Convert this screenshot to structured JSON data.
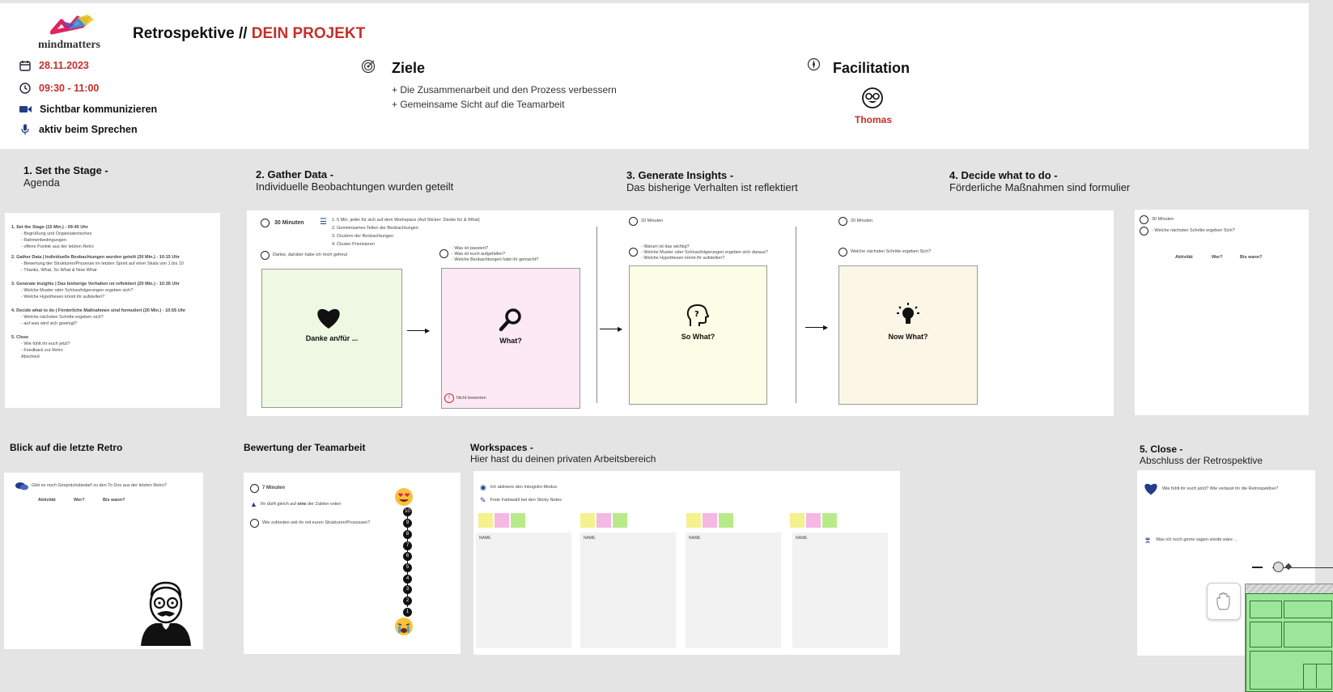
{
  "header": {
    "logo_text": "mindmatters",
    "title_prefix": "Retrospektive // ",
    "title_project": "DEIN PROJEKT",
    "date": "28.11.2023",
    "time": "09:30 - 11:00",
    "rule1": "Sichtbar kommunizieren",
    "rule2": "aktiv beim Sprechen",
    "goals_title": "Ziele",
    "goal1": "+ Die Zusammenarbeit und den Prozess verbessern",
    "goal2": "+ Gemeinsame Sicht auf die Teamarbeit",
    "facilitation_title": "Facilitation",
    "facilitator": "Thomas"
  },
  "stages": {
    "s1_title": "1. Set the Stage -",
    "s1_sub": "Agenda",
    "s2_title": "2. Gather Data -",
    "s2_sub": "Individuelle Beobachtungen wurden geteilt",
    "s3_title": "3. Generate Insights -",
    "s3_sub": "Das bisherige Verhalten  ist reflektiert",
    "s4_title": "4. Decide what to do -",
    "s4_sub": "Förderliche Maßnahmen sind formulier",
    "s5_title": "5. Close -",
    "s5_sub": "Abschluss der Retrospektive"
  },
  "agenda": {
    "i1": "1. Set the Stage (15 Min.) - 09:45 Uhr",
    "i1a": "- Begrüßung und Organisatorisches",
    "i1b": "- Rahmenbedingungen",
    "i1c": "- offene Punkte aus der letzten Retro",
    "i2": "2. Gather Data | Individuelle Beobachtungen wurden geteilt (30 Min.) - 10:15 Uhr",
    "i2a": "- Bewertung der Strukturen/Prozesse im letzten Sprint auf einer Skala von 1 bis 10",
    "i2b": "- Thanks, What, So What & Now What",
    "i3": "3. Generate Insights | Das bisherige Verhalten ist reflektiert (20 Min.) - 10:35 Uhr",
    "i3a": "- Welche Muster oder Schlussfolgerungen ergeben sich?",
    "i3b": "- Welche Hypothesen könnt ihr aufstellen?",
    "i4": "4. Decide what to do | Förderliche Maßnahmen sind formuliert (20 Min.) - 10:55 Uhr",
    "i4a": "- Welche nächsten Schritte ergeben sich?",
    "i4b": "- auf was wird sich geeinigt?",
    "i5": "5. Close",
    "i5a": "- Wie fühlt ihr euch jetzt?",
    "i5b": "- Feedback zur Retro",
    "i5c": "Abschied"
  },
  "gather": {
    "duration": "30 Minuten",
    "step1": "1. 5 Min. jeder für sich auf dem Workspace (Auf Sticker: Danke für & What)",
    "step2": "2. Gemeinsames Teilen der Beobachtungen",
    "step3": "3. Clustern der Beobachtungen",
    "step4": "4. Cluster Priorisieren",
    "q_thanks": "Danke, darüber habe ich mich gefreut",
    "q_what1": "- Was ist passiert?",
    "q_what2": "- Was ist euch aufgefallen?",
    "q_what3": "- Welche Beobachtungen habt ihr gemacht?",
    "card_thanks": "Danke an/für ...",
    "card_what": "What?",
    "no_rating": "Nicht bewerten"
  },
  "insights": {
    "duration": "20 Minuten",
    "q1": "- Warum ist das wichtig?",
    "q2": "- Welche Muster oder Schlussfolgerungen ergeben sich daraus?",
    "q3": "- Welche Hypothesen könnt ihr aufstellen?",
    "card": "So What?"
  },
  "decide": {
    "duration": "20 Minuten",
    "q1": "Welche nächsten Schritte ergeben Sich?",
    "card": "Now What?"
  },
  "actions": {
    "duration": "30 Minuten",
    "q1": "- Welche nächsten Schritte ergeben Sich?",
    "col1": "Aktivität",
    "col2": "Wer?",
    "col3": "Bis wann?"
  },
  "last_retro": {
    "title": "Blick auf die letzte Retro",
    "q": "Gibt es noch Gesprächsbedarf zu den To Dos aus der letzten Retro?",
    "col1": "Aktivität",
    "col2": "Wer?",
    "col3": "Bis wann?"
  },
  "rating": {
    "title": "Bewertung der Teamarbeit",
    "duration": "7 Minuten",
    "instruction_pre": "Ihr dürft gleich auf ",
    "instruction_bold": "eine",
    "instruction_post": " der Zahlen voten",
    "question": "Wie zufrieden seit ihr mit euren Strukturen/Prozessen?",
    "scale": [
      "10",
      "9",
      "8",
      "7",
      "6",
      "5",
      "4",
      "3",
      "2",
      "1"
    ]
  },
  "workspaces": {
    "title": "Workspaces -",
    "sub": "Hier hast du deinen privaten Arbeitsbereich",
    "rule1": "Ich aktiviere den Inkognito-Modus",
    "rule2": "Freie Farbwahl bei den Sticky Notes",
    "name1": "NAME",
    "name2": "NAME",
    "name3": "NAME",
    "name4": "NAME"
  },
  "close": {
    "q1": "Wie fühlt ihr euch jetzt? Wie verlasst ihr die Retrospektive?",
    "q2": "Was ich noch gerne sagen würde wäre ..."
  },
  "colors": {
    "accent_red": "#c4302b",
    "green_note": "#eef8e2",
    "pink_note": "#fde9f6",
    "yellow_note": "#fdfce6",
    "cream_note": "#fcf6e6"
  }
}
